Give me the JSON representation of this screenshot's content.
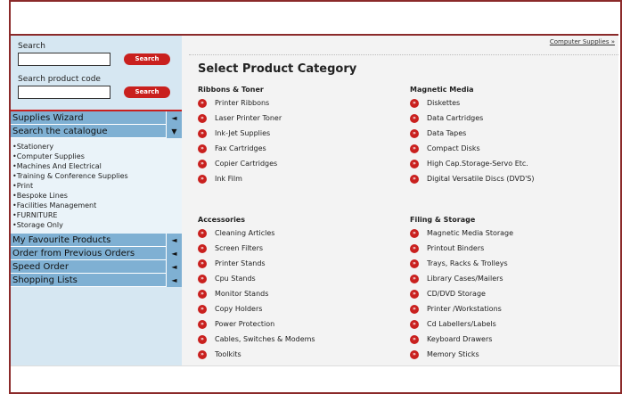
{
  "sidebar": {
    "search_label": "Search",
    "search_button": "Search",
    "code_label": "Search product code",
    "code_button": "Search",
    "nav_top": [
      {
        "label": "Supplies Wizard",
        "arrow": "◄"
      },
      {
        "label": "Search the catalogue",
        "arrow": "▼"
      }
    ],
    "catalogue_items": [
      "•Stationery",
      "•Computer Supplies",
      "•Machines And Electrical",
      "•Training & Conference Supplies",
      "•Print",
      "•Bespoke Lines",
      "•Facilities Management",
      "•FURNITURE",
      "•Storage Only"
    ],
    "nav_bottom": [
      {
        "label": "My Favourite Products",
        "arrow": "◄"
      },
      {
        "label": "Order from Previous Orders",
        "arrow": "◄"
      },
      {
        "label": "Speed Order",
        "arrow": "◄"
      },
      {
        "label": "Shopping Lists",
        "arrow": "◄"
      }
    ]
  },
  "main": {
    "breadcrumb": "Computer Supplies »",
    "title": "Select Product Category",
    "bullet_glyph": "»",
    "sections": [
      {
        "heading": "Ribbons & Toner",
        "items": [
          "Printer Ribbons",
          "Laser Printer Toner",
          "Ink-Jet Supplies",
          "Fax Cartridges",
          "Copier Cartridges",
          "Ink Film"
        ]
      },
      {
        "heading": "Magnetic Media",
        "items": [
          "Diskettes",
          "Data Cartridges",
          "Data Tapes",
          "Compact Disks",
          "High Cap.Storage-Servo Etc.",
          "Digital Versatile Discs (DVD'S)"
        ]
      },
      {
        "heading": "Accessories",
        "items": [
          "Cleaning Articles",
          "Screen Filters",
          "Printer Stands",
          "Cpu Stands",
          "Monitor Stands",
          "Copy Holders",
          "Power Protection",
          "Cables, Switches & Modems",
          "Toolkits"
        ]
      },
      {
        "heading": "Filing & Storage",
        "items": [
          "Magnetic Media Storage",
          "Printout Binders",
          "Trays, Racks & Trolleys",
          "Library Cases/Mailers",
          "CD/DVD Storage",
          "Printer /Workstations",
          "Cd Labellers/Labels",
          "Keyboard Drawers",
          "Memory Sticks"
        ]
      }
    ]
  }
}
